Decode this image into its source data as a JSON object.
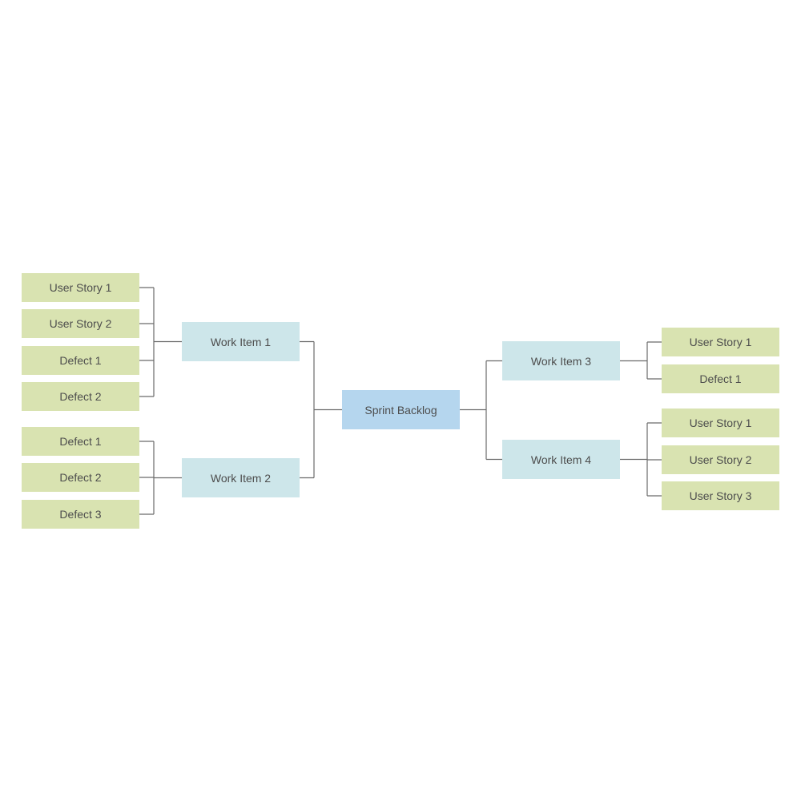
{
  "diagram": {
    "title": "Sprint Backlog",
    "root": {
      "label": "Sprint Backlog",
      "color": "#b5d6ee"
    },
    "colors": {
      "work_item": "#cde6ea",
      "leaf": "#d9e3b1",
      "connector": "#6b6b6b",
      "text": "#4d4d4d"
    },
    "work_items": [
      {
        "label": "Work Item 1",
        "side": "left",
        "children": [
          "User Story 1",
          "User Story 2",
          "Defect 1",
          "Defect 2"
        ]
      },
      {
        "label": "Work Item 2",
        "side": "left",
        "children": [
          "Defect 1",
          "Defect 2",
          "Defect 3"
        ]
      },
      {
        "label": "Work Item 3",
        "side": "right",
        "children": [
          "User Story 1",
          "Defect 1"
        ]
      },
      {
        "label": "Work Item 4",
        "side": "right",
        "children": [
          "User Story 1",
          "User Story 2",
          "User Story 3"
        ]
      }
    ]
  }
}
